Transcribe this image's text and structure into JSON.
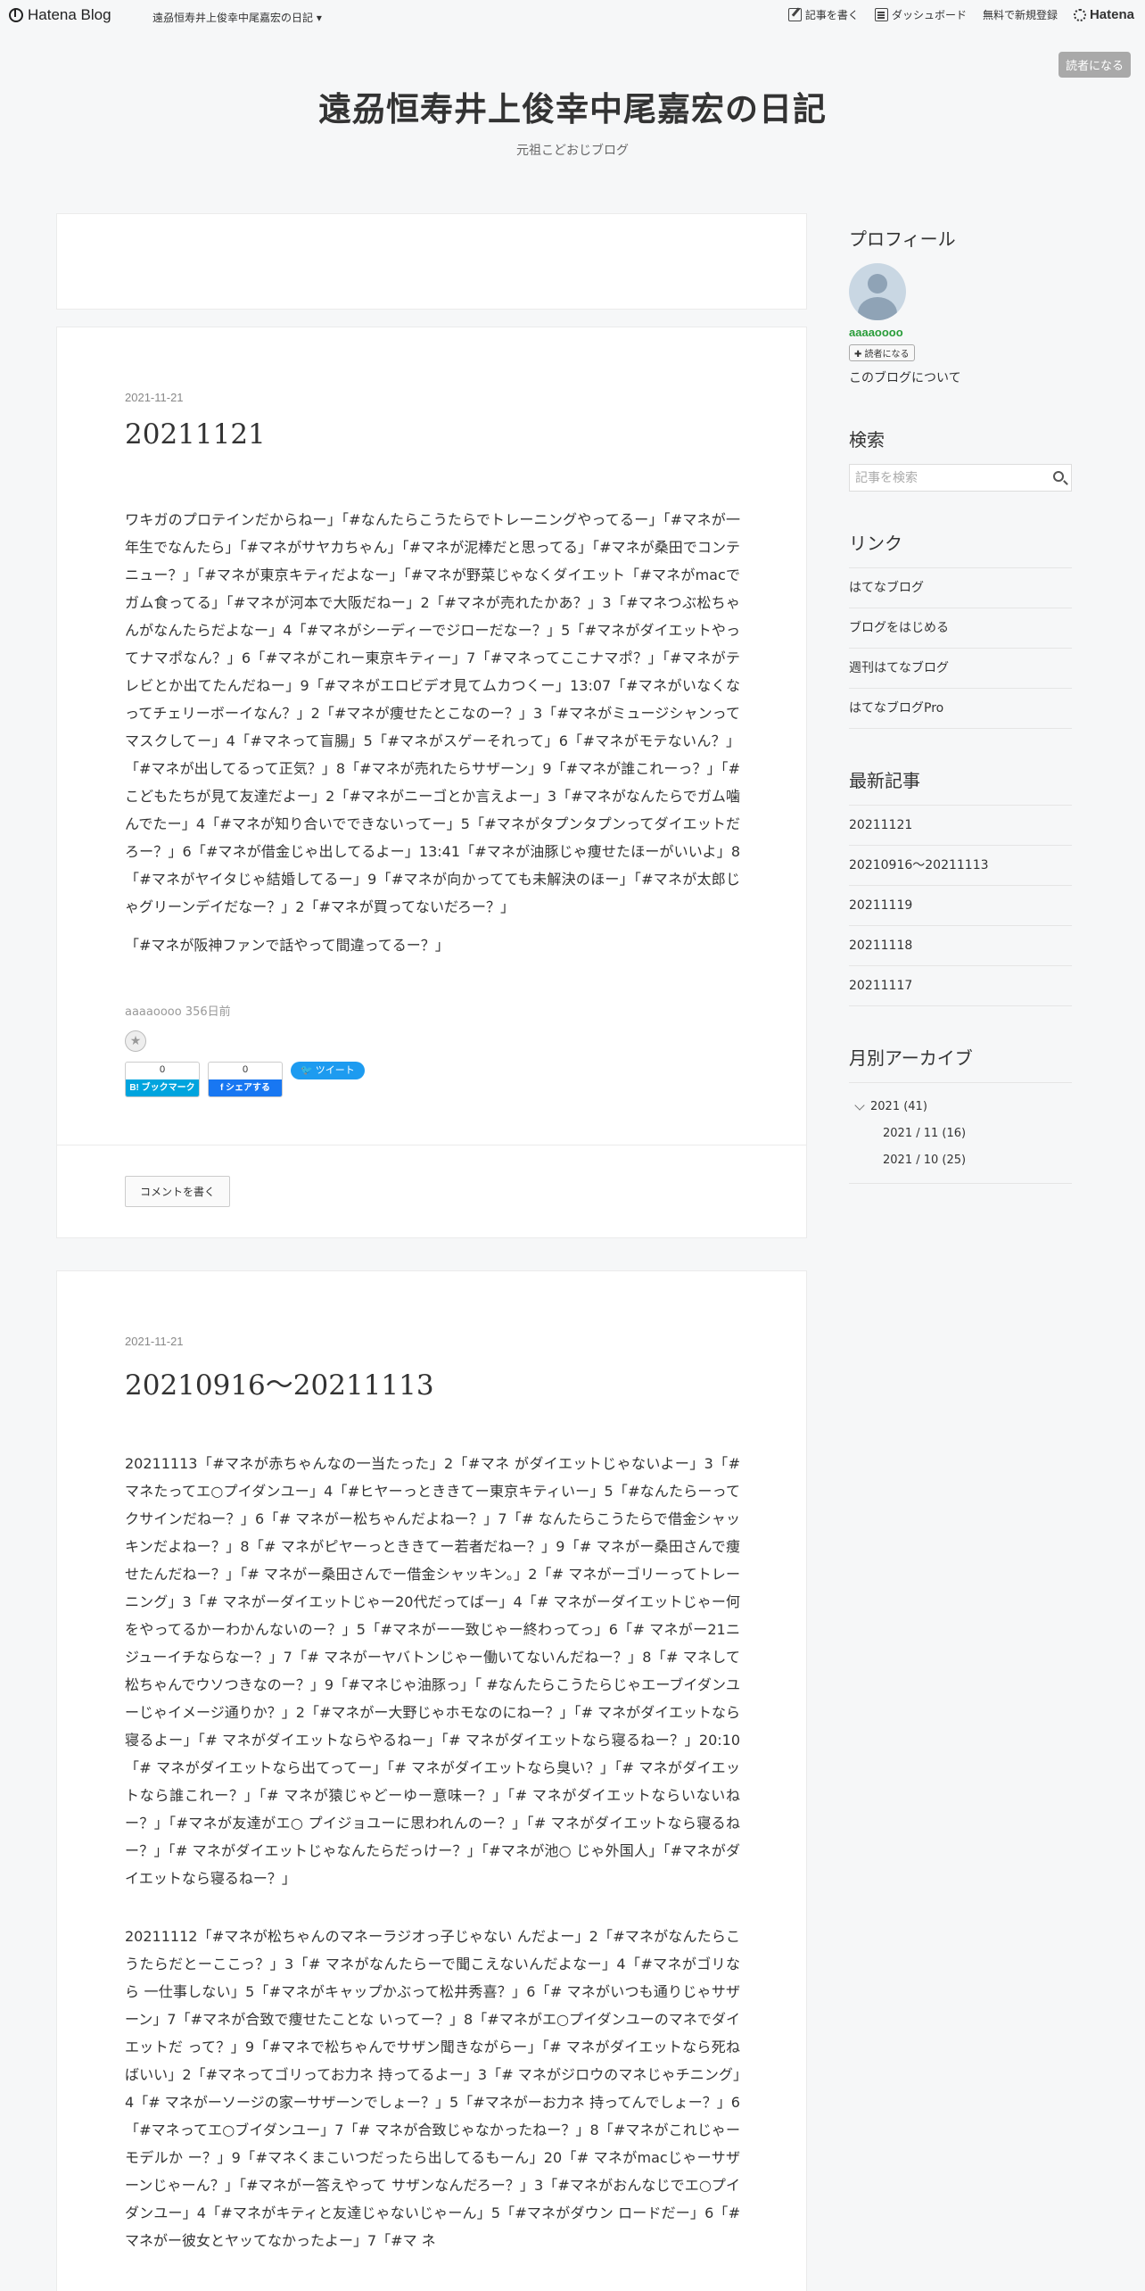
{
  "globalbar": {
    "brand": "Hatena Blog",
    "blog_name": "遠刕恒寿井上俊幸中尾嘉宏の日記",
    "write_label": "記事を書く",
    "dashboard_label": "ダッシュボード",
    "signup_label": "無料で新規登録",
    "hatena_label": "Hatena"
  },
  "header": {
    "subscribe_label": "読者になる",
    "title": "遠刕恒寿井上俊幸中尾嘉宏の日記",
    "description": "元祖こどおじブログ"
  },
  "entries": [
    {
      "date": "2021-11-21",
      "title": "20211121",
      "paragraphs": [
        "ワキガのプロテインだからねー」「#なんたらこうたらでトレーニングやってるー」「#マネが一年生でなんたら」「#マネがサヤカちゃん」「#マネが泥棒だと思ってる」「#マネが桑田でコンテニュー？」「#マネが東京キティだよなー」「#マネが野菜じゃなくダイエット「#マネがmacでガム食ってる」「#マネが河本で大阪だねー」2「#マネが売れたかあ？」3「#マネつぶ松ちゃんがなんたらだよなー」4「#マネがシーディーでジローだなー？」5「#マネがダイエットやってナマポなん？」6「#マネがこれー東京キティー」7「#マネってここナマポ？」「#マネがテレビとか出てたんだねー」9「#マネがエロビデオ見てムカつくー」13:07「#マネがいなくなってチェリーボーイなん？」2「#マネが痩せたとこなのー？」3「#マネがミュージシャンってマスクしてー」4「#マネって盲腸」5「#マネがスゲーそれって」6「#マネがモテないん？」「#マネが出してるって正気？」8「#マネが売れたらサザーン」9「#マネが誰これーっ？」「#こどもたちが見て友達だよー」2「#マネがニーゴとか言えよー」3「#マネがなんたらでガム噛んでたー」4「#マネが知り合いでできないってー」5「#マネがタプンタプンってダイエットだろー？」6「#マネが借金じゃ出してるよー」13:41「#マネが油豚じゃ痩せたほーがいいよ」8「#マネがヤイタじゃ結婚してるー」9「#マネが向かってても未解決のほー」「#マネが太郎じゃグリーンデイだなー？」2「#マネが買ってないだろー？」",
        "「#マネが阪神ファンで話やって間違ってるー？」"
      ],
      "meta": "aaaaoooo 356日前",
      "bookmark_count": "0",
      "bookmark_label": "B! ブックマーク",
      "facebook_count": "0",
      "facebook_label": "f シェアする",
      "tweet_label": "ツイート",
      "comment_label": "コメントを書く"
    },
    {
      "date": "2021-11-21",
      "title": "20210916〜20211113",
      "paragraphs": [
        "20211113「#マネが赤ちゃんなの一当たった」2「#マネ がダイエットじゃないよー」3「#マネたってエ○プイダンユー」4「#ヒヤーっとききてー東京キティいー」5「#なんたらーってクサインだねー？」6「# マネがー松ちゃんだよねー？」7「# なんたらこうたらで借金シャッキンだよねー？」8「# マネがピヤーっとききてー若者だねー？」9「# マネがー桑田さんで痩せたんだねー？」「# マネがー桑田さんでー借金シャッキン。」2「# マネがーゴリーってトレーニング」3「# マネがーダイエットじゃー20代だってばー」4「# マネがーダイエットじゃー何をやってるかーわかんないのー？」5「#マネがー一致じゃー終わってっ」6「# マネがー21ニジューイチならなー？」7「# マネがーヤバトンじゃー働いてないんだねー？」8「# マネして松ちゃんでウソつきなのー？」9「#マネじゃ油豚っ」「 #なんたらこうたらじゃエーブイダンユーじゃイメージ通りか？」2「#マネがー大野じゃホモなのにねー？」「# マネがダイエットなら寝るよー」「# マネがダイエットならやるねー」「# マネがダイエットなら寝るねー？」20:10「# マネがダイエットなら出てってー」「# マネがダイエットなら臭い？」「# マネがダイエットなら誰これー？」「# マネが猿じゃどーゆー意味ー？」「# マネがダイエットならいないねー？」「#マネが友達がエ○ プイジョユーに思われんのー？」「# マネがダイエットなら寝るねー？」「# マネがダイエットじゃなんたらだっけー？」「#マネが池○ じゃ外国人」「#マネがダイエットなら寝るねー？」",
        "20211112「#マネが松ちゃんのマネーラジオっ子じゃない んだよー」2「#マネがなんたらこうたらだとーここっ？」3「# マネがなんたらーで聞こえないんだよなー」4「#マネがゴリなら 一仕事しない」5「#マネがキャップかぶって松井秀喜？」6「# マネがいつも通りじゃサザーン」7「#マネが合致で痩せたことな いってー？」8「#マネがエ○プイダンユーのマネでダイエットだ って？」9「#マネで松ちゃんでサザン聞きながらー」「# マネがダイエットなら死ねばいい」2「#マネってゴリってお力ネ 持ってるよー」3「# マネがジロウのマネじゃチニング」4「# マネがーソージの家ーサザーンでしょー？」5「#マネがーお力ネ 持ってんでしょー？」6「#マネってエ○ブイダンユー」7「# マネが合致じゃなかったねー？」8「#マネがこれじゃーモデルか ー？」9「#マネくまこいつだったら出してるもーん」20「# マネがmacじゃーサザーンじゃーん？」「#マネがー答えやって サザンなんだろー？」3「#マネがおんなじでエ○プイダンユー」4「#マネがキティと友達じゃないじゃーん」5「#マネがダウン ロードだー」6「#マネがー彼女とヤッてなかったよー」7「#マ ネ"
      ]
    }
  ],
  "sidebar": {
    "profile_heading": "プロフィール",
    "profile_name": "aaaaoooo",
    "reader_button": "✚ 読者になる",
    "about_link": "このブログについて",
    "search_heading": "検索",
    "search_placeholder": "記事を検索",
    "links_heading": "リンク",
    "links": [
      "はてなブログ",
      "ブログをはじめる",
      "週刊はてなブログ",
      "はてなブログPro"
    ],
    "recent_heading": "最新記事",
    "recent": [
      "20211121",
      "20210916〜20211113",
      "20211119",
      "20211118",
      "20211117"
    ],
    "archive_heading": "月別アーカイブ",
    "archive_year": "2021 (41)",
    "archive_months": [
      "2021 / 11 (16)",
      "2021 / 10 (25)"
    ]
  }
}
